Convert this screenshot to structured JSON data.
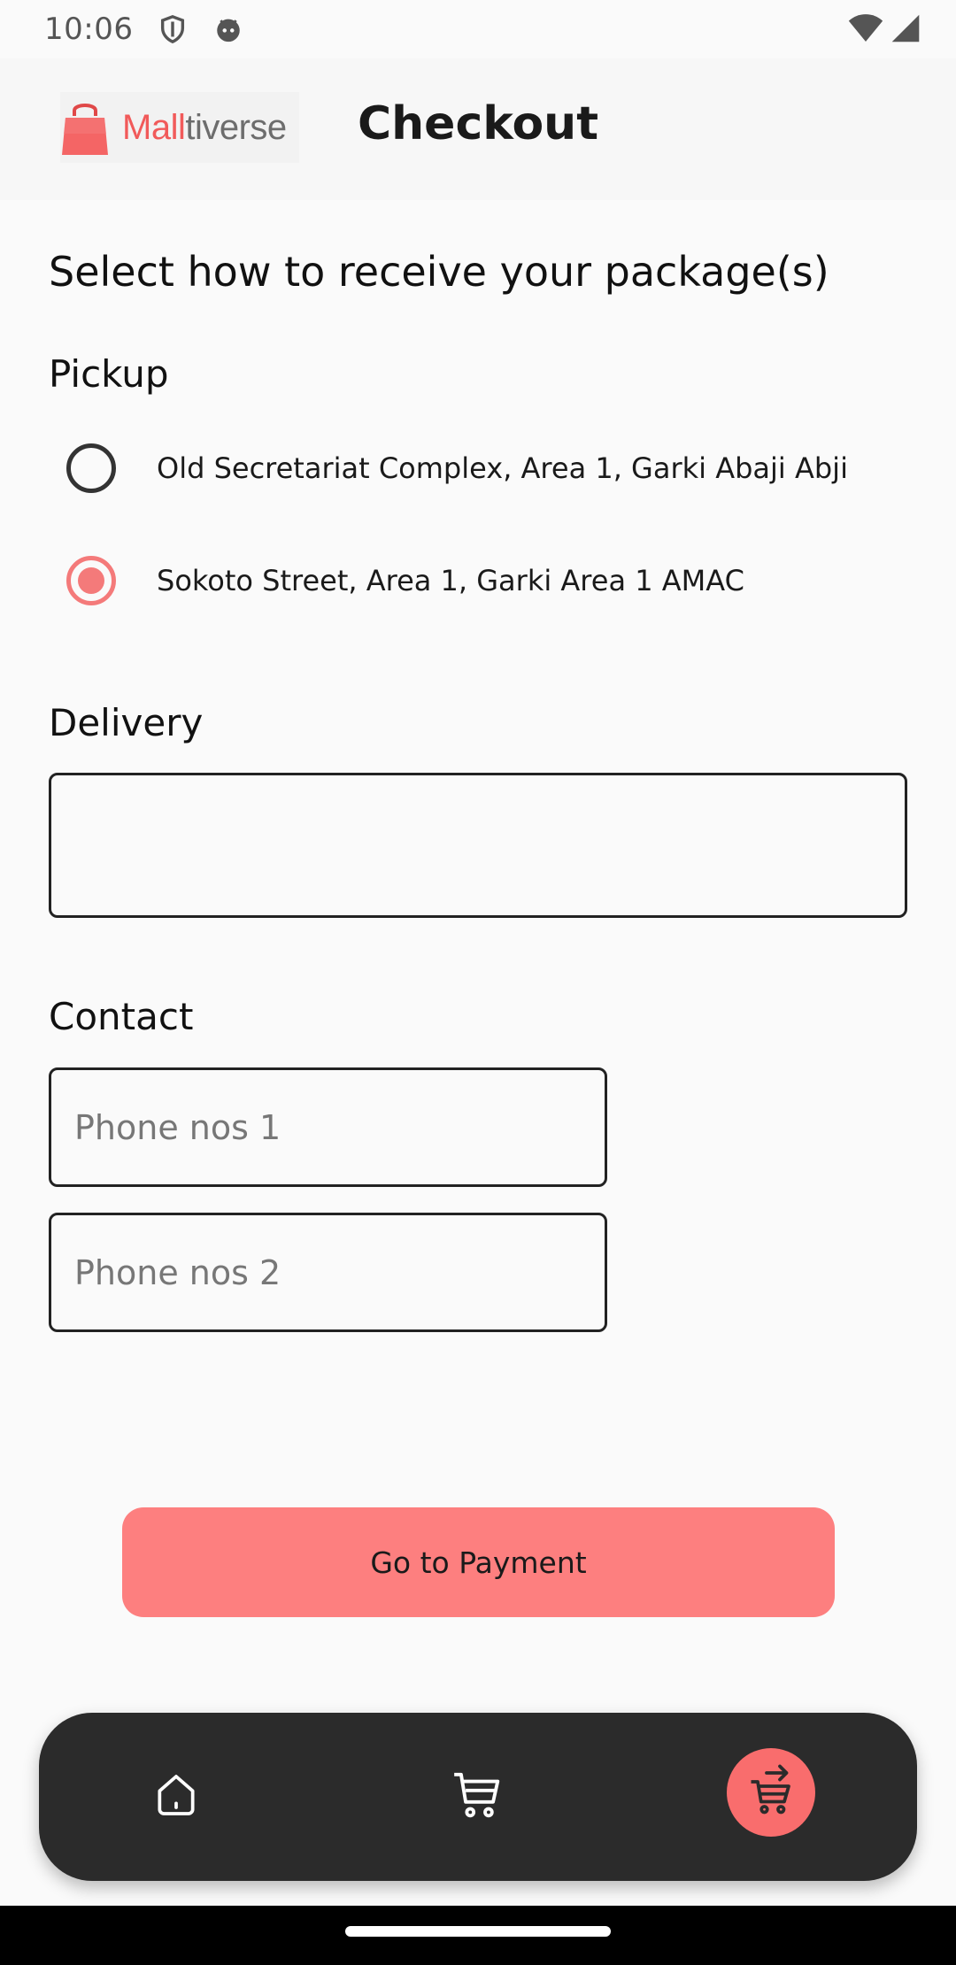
{
  "status_bar": {
    "time": "10:06",
    "icons": [
      "shield-icon",
      "android-face-icon",
      "wifi-icon",
      "signal-icon"
    ]
  },
  "header": {
    "logo_text_accent": "Mall",
    "logo_text_rest": "tiverse",
    "title": "Checkout"
  },
  "main": {
    "heading": "Select how to receive your package(s)",
    "pickup": {
      "label": "Pickup",
      "options": [
        {
          "label": "Old Secretariat Complex, Area 1, Garki Abaji Abji",
          "selected": false
        },
        {
          "label": "Sokoto Street, Area 1, Garki Area 1 AMAC",
          "selected": true
        }
      ]
    },
    "delivery": {
      "label": "Delivery",
      "value": ""
    },
    "contact": {
      "label": "Contact",
      "phone1_placeholder": "Phone nos 1",
      "phone2_placeholder": "Phone nos 2"
    },
    "pay_button_label": "Go to Payment"
  },
  "bottom_nav": {
    "items": [
      {
        "icon": "home-icon",
        "active": false
      },
      {
        "icon": "cart-icon",
        "active": false
      },
      {
        "icon": "checkout-cart-icon",
        "active": true
      }
    ]
  },
  "colors": {
    "accent": "#fd7f7f",
    "radio_selected": "#f47a7a",
    "nav_background": "#2b2b2b",
    "nav_active": "#f96d6d"
  }
}
